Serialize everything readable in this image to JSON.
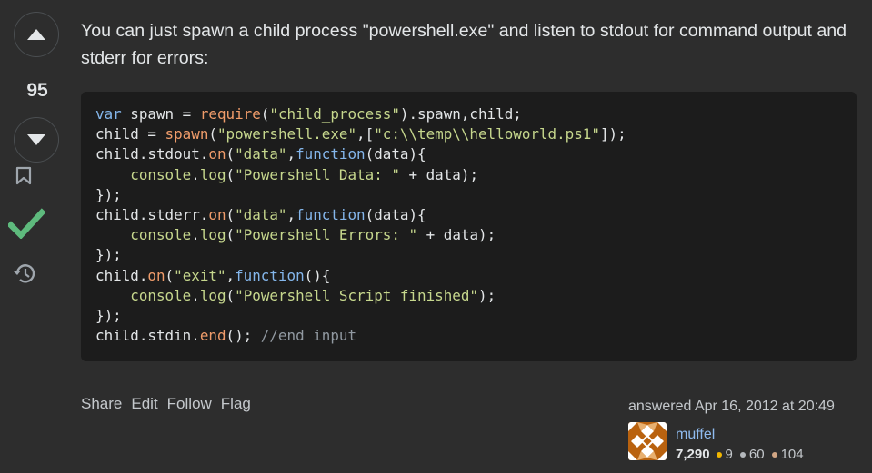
{
  "vote": {
    "score": "95",
    "up_icon": "triangle-up-icon",
    "down_icon": "triangle-down-icon",
    "bookmark_icon": "bookmark-icon",
    "accepted_icon": "checkmark-icon",
    "history_icon": "history-icon",
    "accepted_color": "#5eba7d"
  },
  "answer": {
    "text": "You can just spawn a child process \"powershell.exe\" and listen to stdout for command output and stderr for errors:"
  },
  "code": {
    "lines": [
      [
        [
          "kw",
          "var"
        ],
        [
          "p",
          " spawn = "
        ],
        [
          "fn",
          "require"
        ],
        [
          "p",
          "("
        ],
        [
          "str",
          "\"child_process\""
        ],
        [
          "p",
          ").spawn,child;"
        ]
      ],
      [
        [
          "p",
          "child = "
        ],
        [
          "fn",
          "spawn"
        ],
        [
          "p",
          "("
        ],
        [
          "str",
          "\"powershell.exe\""
        ],
        [
          "p",
          ",["
        ],
        [
          "str",
          "\"c:\\\\temp\\\\helloworld.ps1\""
        ],
        [
          "p",
          "]);"
        ]
      ],
      [
        [
          "p",
          "child.stdout."
        ],
        [
          "fn",
          "on"
        ],
        [
          "p",
          "("
        ],
        [
          "str",
          "\"data\""
        ],
        [
          "p",
          ","
        ],
        [
          "kw",
          "function"
        ],
        [
          "p",
          "(data){"
        ]
      ],
      [
        [
          "p",
          "    "
        ],
        [
          "str",
          "console"
        ],
        [
          "p",
          "."
        ],
        [
          "str",
          "log"
        ],
        [
          "p",
          "("
        ],
        [
          "str",
          "\"Powershell Data: \""
        ],
        [
          "p",
          " + data);"
        ]
      ],
      [
        [
          "p",
          "});"
        ]
      ],
      [
        [
          "p",
          "child.stderr."
        ],
        [
          "fn",
          "on"
        ],
        [
          "p",
          "("
        ],
        [
          "str",
          "\"data\""
        ],
        [
          "p",
          ","
        ],
        [
          "kw",
          "function"
        ],
        [
          "p",
          "(data){"
        ]
      ],
      [
        [
          "p",
          "    "
        ],
        [
          "str",
          "console"
        ],
        [
          "p",
          "."
        ],
        [
          "str",
          "log"
        ],
        [
          "p",
          "("
        ],
        [
          "str",
          "\"Powershell Errors: \""
        ],
        [
          "p",
          " + data);"
        ]
      ],
      [
        [
          "p",
          "});"
        ]
      ],
      [
        [
          "p",
          "child."
        ],
        [
          "fn",
          "on"
        ],
        [
          "p",
          "("
        ],
        [
          "str",
          "\"exit\""
        ],
        [
          "p",
          ","
        ],
        [
          "kw",
          "function"
        ],
        [
          "p",
          "(){"
        ]
      ],
      [
        [
          "p",
          "    "
        ],
        [
          "str",
          "console"
        ],
        [
          "p",
          "."
        ],
        [
          "str",
          "log"
        ],
        [
          "p",
          "("
        ],
        [
          "str",
          "\"Powershell Script finished\""
        ],
        [
          "p",
          ");"
        ]
      ],
      [
        [
          "p",
          "});"
        ]
      ],
      [
        [
          "p",
          "child.stdin."
        ],
        [
          "fn",
          "end"
        ],
        [
          "p",
          "(); "
        ],
        [
          "cmt",
          "//end input"
        ]
      ]
    ]
  },
  "actions": {
    "share": "Share",
    "edit": "Edit",
    "follow": "Follow",
    "flag": "Flag"
  },
  "user_card": {
    "answered": "answered Apr 16, 2012 at 20:49",
    "avatar_icon": "identicon-avatar",
    "username": "muffel",
    "reputation": "7,290",
    "gold": "9",
    "silver": "60",
    "bronze": "104",
    "gold_color": "#f1b600",
    "silver_color": "#b4b8bc",
    "bronze_color": "#d1a684"
  }
}
